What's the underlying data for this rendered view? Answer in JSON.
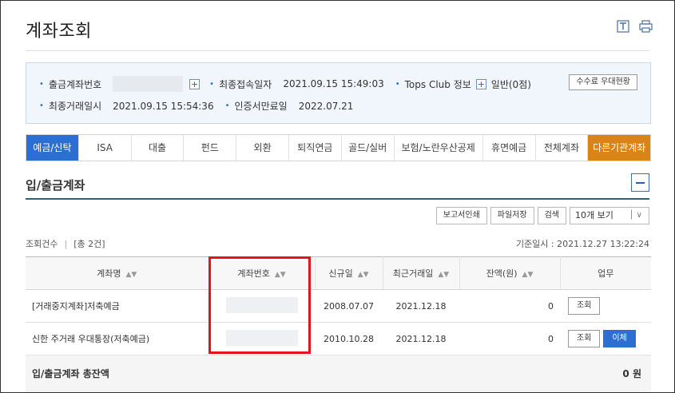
{
  "header": {
    "title": "계좌조회"
  },
  "info": {
    "account_label": "출금계좌번호",
    "last_access_label": "최종접속일자",
    "last_access_value": "2021.09.15 15:49:03",
    "tops_label": "Tops Club 정보",
    "tops_value": "일반(0점)",
    "fee_button": "수수료 우대현황",
    "last_tx_label": "최종거래일시",
    "last_tx_value": "2021.09.15 15:54:36",
    "cert_label": "인증서만료일",
    "cert_value": "2022.07.21"
  },
  "tabs": [
    "예금/신탁",
    "ISA",
    "대출",
    "펀드",
    "외환",
    "퇴직연금",
    "골드/실버",
    "보험/노란우산공제",
    "휴면예금",
    "전체계좌",
    "다른기관계좌"
  ],
  "section": {
    "title": "입/출금계좌",
    "toolbar": {
      "report": "보고서인쇄",
      "save": "파일저장",
      "search": "검색",
      "page_size": "10개 보기"
    },
    "count_label": "조회건수",
    "count_value": "[총 2건]",
    "base_time": "기준일시 : 2021.12.27 13:22:24"
  },
  "table": {
    "columns": [
      "계좌명",
      "계좌번호",
      "신규일",
      "최근거래일",
      "잔액(원)",
      "업무"
    ],
    "rows": [
      {
        "name": "[거래중지계좌]저축예금",
        "opened": "2008.07.07",
        "recent": "2021.12.18",
        "balance": "0",
        "view": "조회"
      },
      {
        "name": "신한 주거래 우대통장(저축예금)",
        "opened": "2010.10.28",
        "recent": "2021.12.18",
        "balance": "0",
        "view": "조회",
        "transfer": "이체"
      }
    ],
    "total_label": "입/출금계좌 총잔액",
    "total_value": "0 원"
  }
}
